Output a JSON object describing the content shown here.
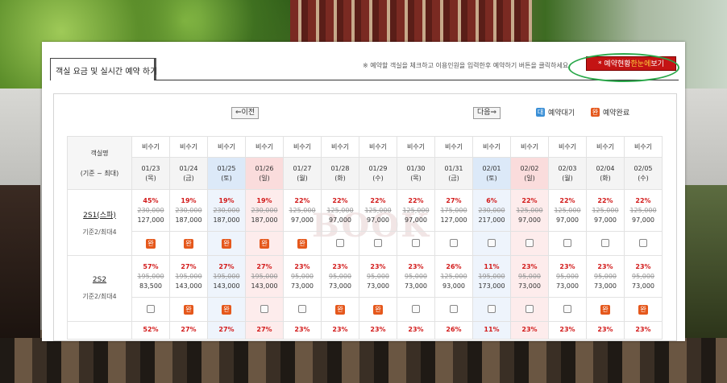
{
  "title_tab": "객실 요금 및 실시간 예약 하기",
  "notice": "※ 예약할 객실을 체크하고 이용인원을 입력한후 예약하기 버튼을 클릭하세요.",
  "status_button": {
    "prefix": "* 예약현황",
    "highlight": "한눈에",
    "suffix": "보기"
  },
  "nav": {
    "prev": "⇐이전",
    "next": "다음⇒"
  },
  "legend": {
    "wait": {
      "icon": "대",
      "label": "예약대기"
    },
    "done": {
      "icon": "완",
      "label": "예약완료"
    }
  },
  "watermark": "BOOK",
  "table": {
    "room_header": "객실명",
    "room_sub": "(기준 ~ 최대)",
    "days": [
      {
        "season": "비수기",
        "date": "01/23",
        "dow": "(목)",
        "type": ""
      },
      {
        "season": "비수기",
        "date": "01/24",
        "dow": "(금)",
        "type": ""
      },
      {
        "season": "비수기",
        "date": "01/25",
        "dow": "(토)",
        "type": "sat"
      },
      {
        "season": "비수기",
        "date": "01/26",
        "dow": "(일)",
        "type": "sun"
      },
      {
        "season": "비수기",
        "date": "01/27",
        "dow": "(월)",
        "type": ""
      },
      {
        "season": "비수기",
        "date": "01/28",
        "dow": "(화)",
        "type": ""
      },
      {
        "season": "비수기",
        "date": "01/29",
        "dow": "(수)",
        "type": ""
      },
      {
        "season": "비수기",
        "date": "01/30",
        "dow": "(목)",
        "type": ""
      },
      {
        "season": "비수기",
        "date": "01/31",
        "dow": "(금)",
        "type": ""
      },
      {
        "season": "비수기",
        "date": "02/01",
        "dow": "(토)",
        "type": "sat"
      },
      {
        "season": "비수기",
        "date": "02/02",
        "dow": "(일)",
        "type": "sun"
      },
      {
        "season": "비수기",
        "date": "02/03",
        "dow": "(월)",
        "type": ""
      },
      {
        "season": "비수기",
        "date": "02/04",
        "dow": "(화)",
        "type": ""
      },
      {
        "season": "비수기",
        "date": "02/05",
        "dow": "(수)",
        "type": ""
      }
    ],
    "rooms": [
      {
        "name": "2S1(스파)",
        "capacity": "기준2/최대4",
        "cells": [
          {
            "pct": "45%",
            "orig": "230,000",
            "sale": "127,000",
            "done": true
          },
          {
            "pct": "19%",
            "orig": "230,000",
            "sale": "187,000",
            "done": true
          },
          {
            "pct": "19%",
            "orig": "230,000",
            "sale": "187,000",
            "done": true
          },
          {
            "pct": "19%",
            "orig": "230,000",
            "sale": "187,000",
            "done": true
          },
          {
            "pct": "22%",
            "orig": "125,000",
            "sale": "97,000",
            "done": true
          },
          {
            "pct": "22%",
            "orig": "125,000",
            "sale": "97,000",
            "done": false
          },
          {
            "pct": "22%",
            "orig": "125,000",
            "sale": "97,000",
            "done": false
          },
          {
            "pct": "22%",
            "orig": "125,000",
            "sale": "97,000",
            "done": false
          },
          {
            "pct": "27%",
            "orig": "175,000",
            "sale": "127,000",
            "done": false
          },
          {
            "pct": "6%",
            "orig": "230,000",
            "sale": "217,000",
            "done": false
          },
          {
            "pct": "22%",
            "orig": "125,000",
            "sale": "97,000",
            "done": false
          },
          {
            "pct": "22%",
            "orig": "125,000",
            "sale": "97,000",
            "done": false
          },
          {
            "pct": "22%",
            "orig": "125,000",
            "sale": "97,000",
            "done": false
          },
          {
            "pct": "22%",
            "orig": "125,000",
            "sale": "97,000",
            "done": false
          }
        ]
      },
      {
        "name": "2S2",
        "capacity": "기준2/최대4",
        "cells": [
          {
            "pct": "57%",
            "orig": "195,000",
            "sale": "83,500",
            "done": false
          },
          {
            "pct": "27%",
            "orig": "195,000",
            "sale": "143,000",
            "done": true
          },
          {
            "pct": "27%",
            "orig": "195,000",
            "sale": "143,000",
            "done": true
          },
          {
            "pct": "27%",
            "orig": "195,000",
            "sale": "143,000",
            "done": false
          },
          {
            "pct": "23%",
            "orig": "95,000",
            "sale": "73,000",
            "done": false
          },
          {
            "pct": "23%",
            "orig": "95,000",
            "sale": "73,000",
            "done": true
          },
          {
            "pct": "23%",
            "orig": "95,000",
            "sale": "73,000",
            "done": true
          },
          {
            "pct": "23%",
            "orig": "95,000",
            "sale": "73,000",
            "done": false
          },
          {
            "pct": "26%",
            "orig": "125,000",
            "sale": "93,000",
            "done": false
          },
          {
            "pct": "11%",
            "orig": "195,000",
            "sale": "173,000",
            "done": false
          },
          {
            "pct": "23%",
            "orig": "95,000",
            "sale": "73,000",
            "done": false
          },
          {
            "pct": "23%",
            "orig": "95,000",
            "sale": "73,000",
            "done": false
          },
          {
            "pct": "23%",
            "orig": "95,000",
            "sale": "73,000",
            "done": true
          },
          {
            "pct": "23%",
            "orig": "95,000",
            "sale": "73,000",
            "done": true
          }
        ]
      },
      {
        "name": "",
        "capacity": "",
        "partial": true,
        "cells": [
          {
            "pct": "52%"
          },
          {
            "pct": "27%"
          },
          {
            "pct": "27%"
          },
          {
            "pct": "27%"
          },
          {
            "pct": "23%"
          },
          {
            "pct": "23%"
          },
          {
            "pct": "23%"
          },
          {
            "pct": "23%"
          },
          {
            "pct": "26%"
          },
          {
            "pct": "11%"
          },
          {
            "pct": "23%"
          },
          {
            "pct": "23%"
          },
          {
            "pct": "23%"
          },
          {
            "pct": "23%"
          }
        ]
      }
    ]
  }
}
